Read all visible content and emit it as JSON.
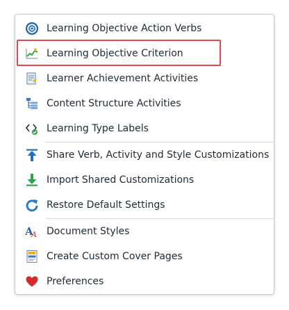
{
  "menu": {
    "items": [
      {
        "label": "Learning Objective Action Verbs",
        "icon": "target-icon"
      },
      {
        "label": "Learning Objective Criterion",
        "icon": "sparkline-chart-icon"
      },
      {
        "label": "Learner Achievement Activities",
        "icon": "document-edit-icon"
      },
      {
        "label": "Content Structure Activities",
        "icon": "tree-structure-icon"
      },
      {
        "label": "Learning Type Labels",
        "icon": "tag-check-icon"
      },
      {
        "label": "Share Verb, Activity and Style Customizations",
        "icon": "upload-arrow-icon"
      },
      {
        "label": "Import Shared Customizations",
        "icon": "download-arrow-icon"
      },
      {
        "label": "Restore Default Settings",
        "icon": "restore-icon"
      },
      {
        "label": "Document Styles",
        "icon": "text-style-icon"
      },
      {
        "label": "Create Custom Cover Pages",
        "icon": "cover-page-icon"
      },
      {
        "label": "Preferences",
        "icon": "heart-icon"
      }
    ]
  },
  "colors": {
    "highlight_border": "#e5484d",
    "text": "#1f2a37",
    "separator": "#d8dbe0"
  }
}
